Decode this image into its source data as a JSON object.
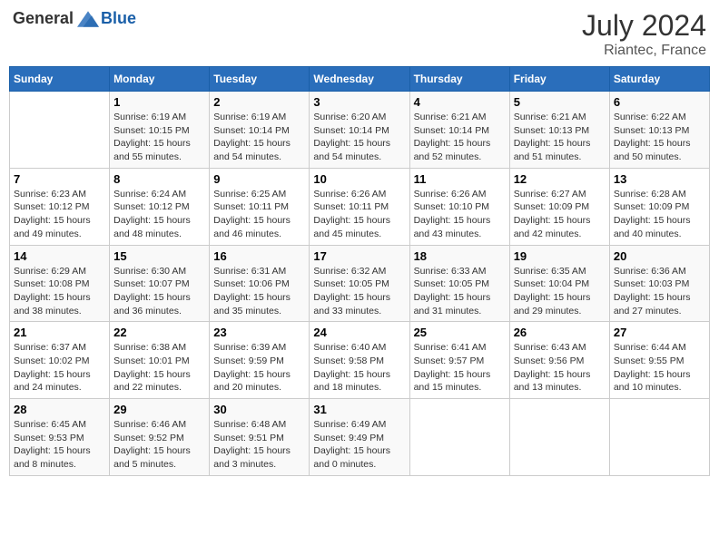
{
  "header": {
    "logo_general": "General",
    "logo_blue": "Blue",
    "month_year": "July 2024",
    "location": "Riantec, France"
  },
  "days_of_week": [
    "Sunday",
    "Monday",
    "Tuesday",
    "Wednesday",
    "Thursday",
    "Friday",
    "Saturday"
  ],
  "weeks": [
    [
      {
        "day": "",
        "info": ""
      },
      {
        "day": "1",
        "info": "Sunrise: 6:19 AM\nSunset: 10:15 PM\nDaylight: 15 hours\nand 55 minutes."
      },
      {
        "day": "2",
        "info": "Sunrise: 6:19 AM\nSunset: 10:14 PM\nDaylight: 15 hours\nand 54 minutes."
      },
      {
        "day": "3",
        "info": "Sunrise: 6:20 AM\nSunset: 10:14 PM\nDaylight: 15 hours\nand 54 minutes."
      },
      {
        "day": "4",
        "info": "Sunrise: 6:21 AM\nSunset: 10:14 PM\nDaylight: 15 hours\nand 52 minutes."
      },
      {
        "day": "5",
        "info": "Sunrise: 6:21 AM\nSunset: 10:13 PM\nDaylight: 15 hours\nand 51 minutes."
      },
      {
        "day": "6",
        "info": "Sunrise: 6:22 AM\nSunset: 10:13 PM\nDaylight: 15 hours\nand 50 minutes."
      }
    ],
    [
      {
        "day": "7",
        "info": "Sunrise: 6:23 AM\nSunset: 10:12 PM\nDaylight: 15 hours\nand 49 minutes."
      },
      {
        "day": "8",
        "info": "Sunrise: 6:24 AM\nSunset: 10:12 PM\nDaylight: 15 hours\nand 48 minutes."
      },
      {
        "day": "9",
        "info": "Sunrise: 6:25 AM\nSunset: 10:11 PM\nDaylight: 15 hours\nand 46 minutes."
      },
      {
        "day": "10",
        "info": "Sunrise: 6:26 AM\nSunset: 10:11 PM\nDaylight: 15 hours\nand 45 minutes."
      },
      {
        "day": "11",
        "info": "Sunrise: 6:26 AM\nSunset: 10:10 PM\nDaylight: 15 hours\nand 43 minutes."
      },
      {
        "day": "12",
        "info": "Sunrise: 6:27 AM\nSunset: 10:09 PM\nDaylight: 15 hours\nand 42 minutes."
      },
      {
        "day": "13",
        "info": "Sunrise: 6:28 AM\nSunset: 10:09 PM\nDaylight: 15 hours\nand 40 minutes."
      }
    ],
    [
      {
        "day": "14",
        "info": "Sunrise: 6:29 AM\nSunset: 10:08 PM\nDaylight: 15 hours\nand 38 minutes."
      },
      {
        "day": "15",
        "info": "Sunrise: 6:30 AM\nSunset: 10:07 PM\nDaylight: 15 hours\nand 36 minutes."
      },
      {
        "day": "16",
        "info": "Sunrise: 6:31 AM\nSunset: 10:06 PM\nDaylight: 15 hours\nand 35 minutes."
      },
      {
        "day": "17",
        "info": "Sunrise: 6:32 AM\nSunset: 10:05 PM\nDaylight: 15 hours\nand 33 minutes."
      },
      {
        "day": "18",
        "info": "Sunrise: 6:33 AM\nSunset: 10:05 PM\nDaylight: 15 hours\nand 31 minutes."
      },
      {
        "day": "19",
        "info": "Sunrise: 6:35 AM\nSunset: 10:04 PM\nDaylight: 15 hours\nand 29 minutes."
      },
      {
        "day": "20",
        "info": "Sunrise: 6:36 AM\nSunset: 10:03 PM\nDaylight: 15 hours\nand 27 minutes."
      }
    ],
    [
      {
        "day": "21",
        "info": "Sunrise: 6:37 AM\nSunset: 10:02 PM\nDaylight: 15 hours\nand 24 minutes."
      },
      {
        "day": "22",
        "info": "Sunrise: 6:38 AM\nSunset: 10:01 PM\nDaylight: 15 hours\nand 22 minutes."
      },
      {
        "day": "23",
        "info": "Sunrise: 6:39 AM\nSunset: 9:59 PM\nDaylight: 15 hours\nand 20 minutes."
      },
      {
        "day": "24",
        "info": "Sunrise: 6:40 AM\nSunset: 9:58 PM\nDaylight: 15 hours\nand 18 minutes."
      },
      {
        "day": "25",
        "info": "Sunrise: 6:41 AM\nSunset: 9:57 PM\nDaylight: 15 hours\nand 15 minutes."
      },
      {
        "day": "26",
        "info": "Sunrise: 6:43 AM\nSunset: 9:56 PM\nDaylight: 15 hours\nand 13 minutes."
      },
      {
        "day": "27",
        "info": "Sunrise: 6:44 AM\nSunset: 9:55 PM\nDaylight: 15 hours\nand 10 minutes."
      }
    ],
    [
      {
        "day": "28",
        "info": "Sunrise: 6:45 AM\nSunset: 9:53 PM\nDaylight: 15 hours\nand 8 minutes."
      },
      {
        "day": "29",
        "info": "Sunrise: 6:46 AM\nSunset: 9:52 PM\nDaylight: 15 hours\nand 5 minutes."
      },
      {
        "day": "30",
        "info": "Sunrise: 6:48 AM\nSunset: 9:51 PM\nDaylight: 15 hours\nand 3 minutes."
      },
      {
        "day": "31",
        "info": "Sunrise: 6:49 AM\nSunset: 9:49 PM\nDaylight: 15 hours\nand 0 minutes."
      },
      {
        "day": "",
        "info": ""
      },
      {
        "day": "",
        "info": ""
      },
      {
        "day": "",
        "info": ""
      }
    ]
  ]
}
